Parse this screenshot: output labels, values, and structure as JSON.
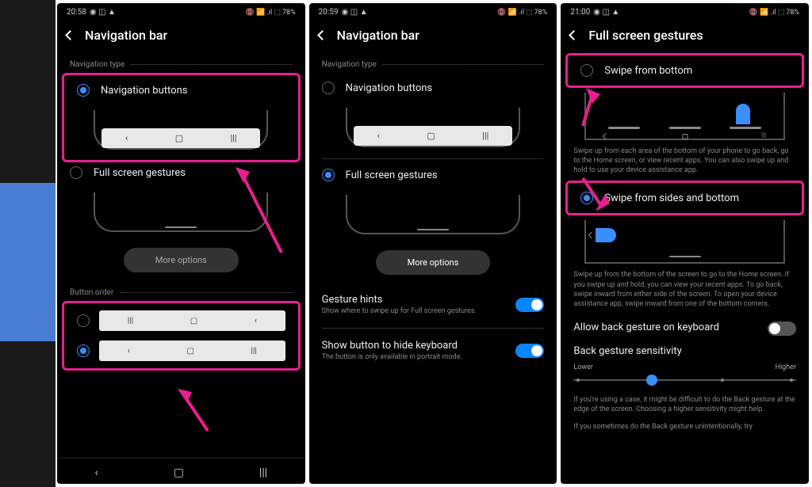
{
  "statusBar": {
    "time1": "20:58",
    "time2": "20:59",
    "time3": "21:00",
    "battery": "78%",
    "signal": "📶"
  },
  "s1": {
    "title": "Navigation bar",
    "sectionType": "Navigation type",
    "optButtons": "Navigation buttons",
    "optGestures": "Full screen gestures",
    "moreOptions": "More options",
    "sectionOrder": "Button order"
  },
  "s2": {
    "title": "Navigation bar",
    "sectionType": "Navigation type",
    "optButtons": "Navigation buttons",
    "optGestures": "Full screen gestures",
    "moreOptions": "More options",
    "hintsTitle": "Gesture hints",
    "hintsDesc": "Show where to swipe up for Full screen gestures.",
    "kbdTitle": "Show button to hide keyboard",
    "kbdDesc": "The button is only available in portrait mode."
  },
  "s3": {
    "title": "Full screen gestures",
    "optBottom": "Swipe from bottom",
    "bottomDesc": "Swipe up from each area of the bottom of your phone to go back, go to the Home screen, or view recent apps. You can also swipe up and hold to use your device assistance app.",
    "optSides": "Swipe from sides and bottom",
    "sidesDesc": "Swipe up from the bottom of the screen to go to the Home screen. If you swipe up and hold, you can view your recent apps. To go back, swipe inward from either side of the screen. To open your device assistance app, swipe inward from one of the bottom corners.",
    "allowKbd": "Allow back gesture on keyboard",
    "sensTitle": "Back gesture sensitivity",
    "sensLower": "Lower",
    "sensHigher": "Higher",
    "caseDesc": "If you're using a case, it might be difficult to do the Back gesture at the edge of the screen. Choosing a higher sensitivity might help.",
    "sometimesDesc": "If you sometimes do the Back gesture unintentionally, try"
  }
}
